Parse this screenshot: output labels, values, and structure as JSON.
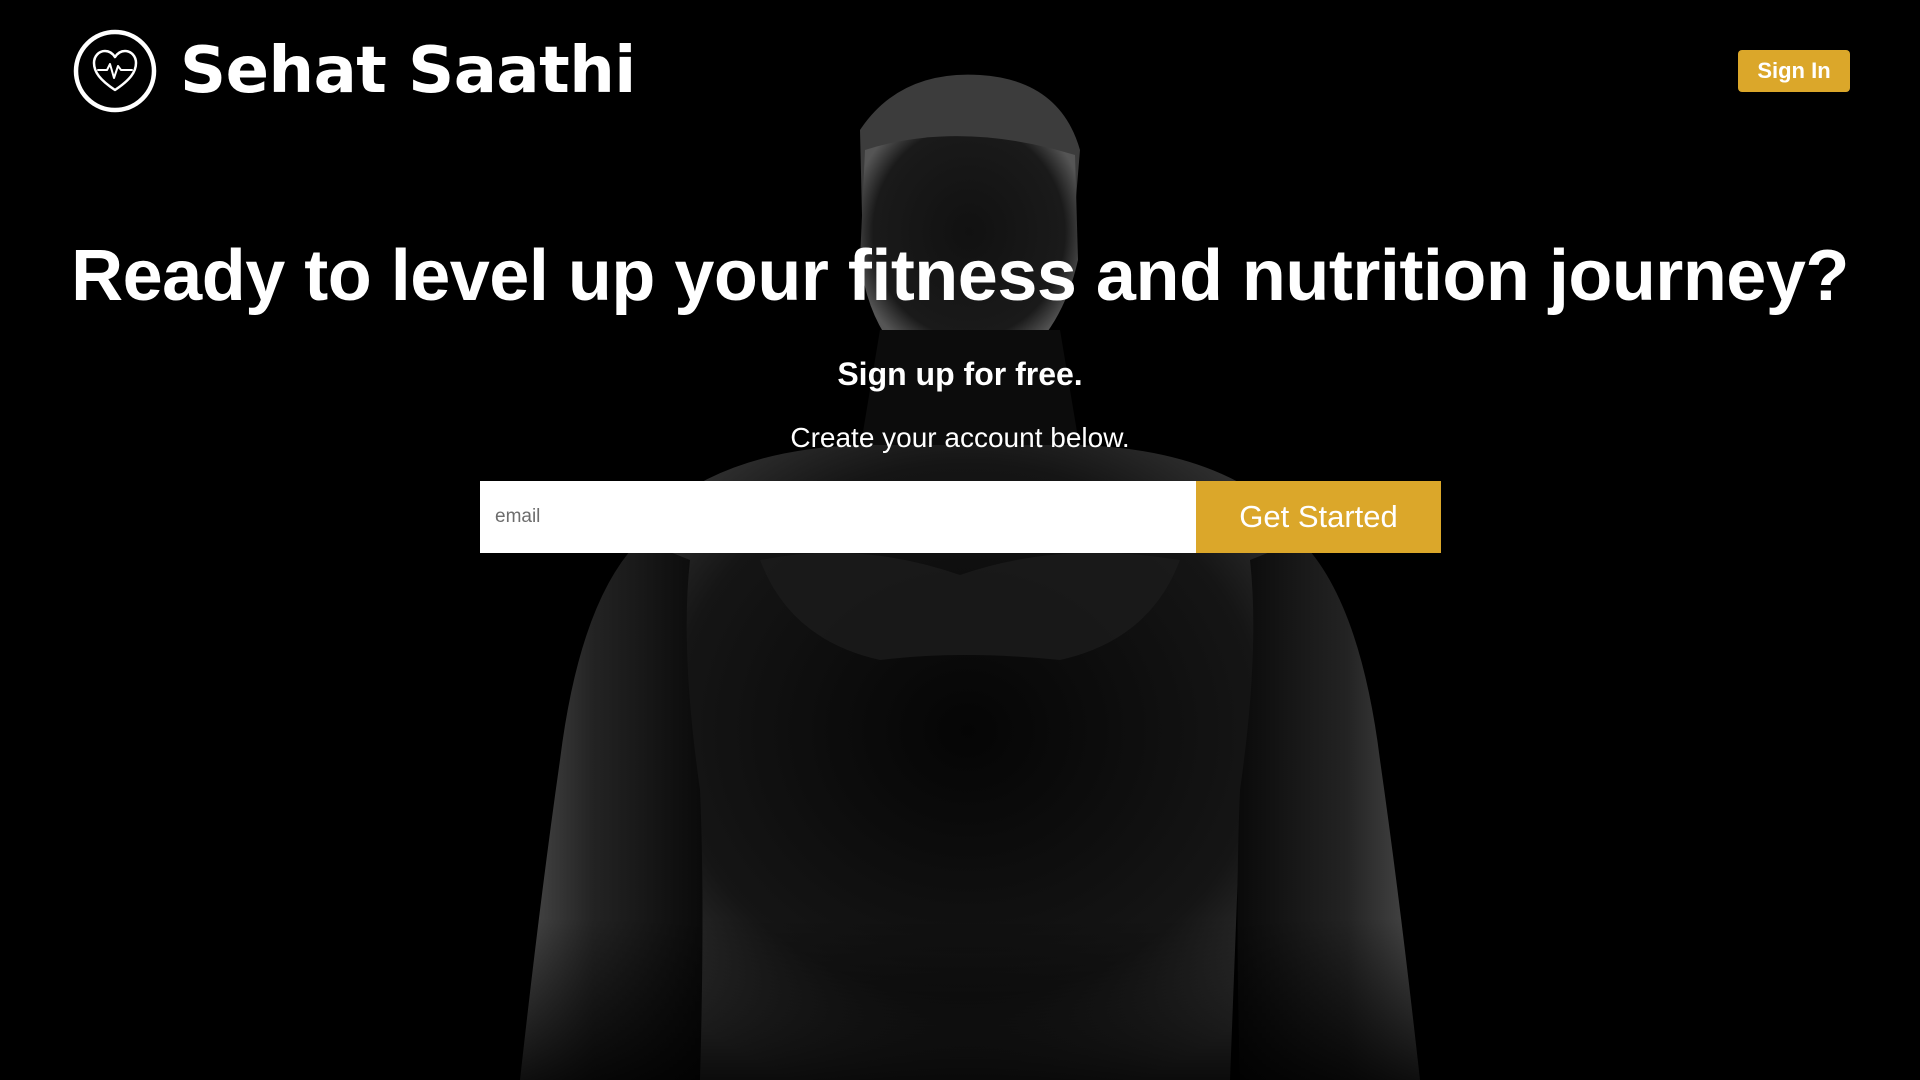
{
  "header": {
    "brand_name": "Sehat Saathi",
    "logo_icon": "heart-pulse-icon",
    "sign_in_label": "Sign In"
  },
  "hero": {
    "headline": "Ready to level up your fitness and nutrition journey?",
    "subheadline": "Sign up for free.",
    "tagline": "Create your account below.",
    "email_placeholder": "email",
    "email_value": "",
    "cta_label": "Get Started",
    "background_image": "silhouette of muscular man"
  },
  "colors": {
    "accent": "#dba72a",
    "background": "#000000",
    "text": "#ffffff"
  }
}
